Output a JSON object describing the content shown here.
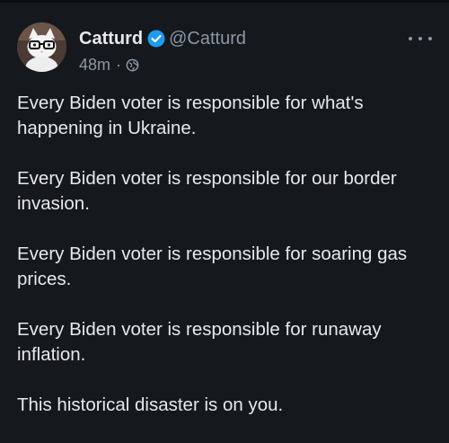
{
  "tweet": {
    "display_name": "Catturd",
    "handle": "@Catturd",
    "time": "48m",
    "separator": "·",
    "verified": true,
    "audience_icon": "globe-icon",
    "more_icon": "more-options-icon",
    "avatar_icon": "cat-with-glasses-avatar",
    "paragraphs": [
      "Every Biden voter is responsible for what's happening in Ukraine.",
      "Every Biden voter is responsible for our border invasion.",
      "Every Biden voter is responsible for soaring gas prices.",
      "Every Biden voter is responsible for runaway inflation.",
      "This historical disaster is on you."
    ]
  },
  "colors": {
    "background": "#15181c",
    "text": "#e7e9ea",
    "secondary_text": "#8b98a5",
    "verified_blue": "#1d9bf0"
  }
}
